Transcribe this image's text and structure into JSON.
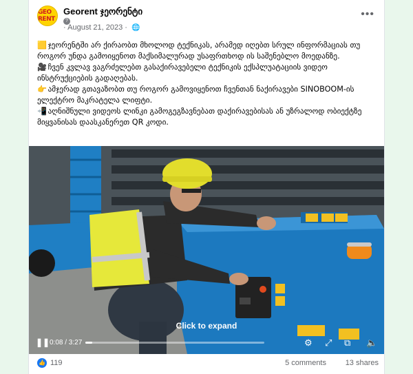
{
  "post": {
    "page_name": "Georent ჯეორენტი",
    "logo_text": "GEO RENT",
    "date": "August 21, 2023",
    "paragraphs": [
      {
        "emoji": "🟨",
        "text": "ჯეორენტში არ ქირაობთ მხოლოდ ტექნიკას, არამედ იღებთ სრულ ინფორმაციას თუ როგორ უნდა გამოიყენოთ მაქსიმალურად უსაფრთხოდ ის საშენებლო მოედანზე."
      },
      {
        "emoji": "🎥",
        "text": "ჩვენ კვლავ ვაგრძელებთ გასაქირავებელი ტექნიკის ექსპლუატაციის ვიდეო ინსტრუქციების გადაღებას."
      },
      {
        "emoji": "👉",
        "text": "ამჯერად გთავაზობთ თუ როგორ გამოვიყენოთ ჩვენთან ნაქირავები SINOBOOM-ის ელექტრო მაკრატელა ლიფტი."
      },
      {
        "emoji": "📲",
        "text": "აღნიშნული ვიდეოს ლინკი გამოგეგზავნებათ დაქირავებისას  ან უზრალოდ ობიექტზე მიყვანისას დაასკანერეთ QR კოდი."
      }
    ]
  },
  "video": {
    "expand_text": "Click to expand",
    "time": "0:08 / 3:27",
    "progress": 0.04,
    "icons": [
      "pause-icon",
      "settings-icon",
      "fullscreen-icon",
      "pip-icon",
      "mute-icon"
    ]
  },
  "footer": {
    "likes": "119",
    "comments": "5 comments",
    "shares": "13 shares"
  },
  "colors": {
    "accent": "#1877f2",
    "brand_yellow": "#ffd400",
    "lift_blue": "#1f7fc4"
  }
}
